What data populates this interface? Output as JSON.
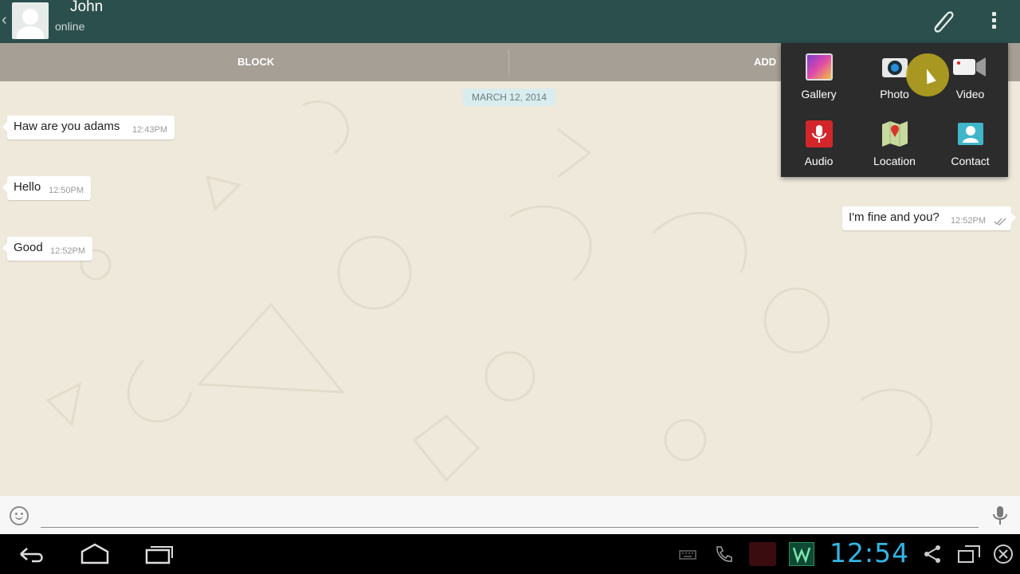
{
  "header": {
    "name": "John",
    "status": "online"
  },
  "actions": {
    "block": "BLOCK",
    "add": "ADD"
  },
  "chat": {
    "date": "MARCH 12, 2014",
    "messages": [
      {
        "text": "Haw are you adams",
        "time": "12:43PM",
        "dir": "in"
      },
      {
        "text": "Hello",
        "time": "12:50PM",
        "dir": "in"
      },
      {
        "text": "Good",
        "time": "12:52PM",
        "dir": "in"
      },
      {
        "text": "I'm fine and you?",
        "time": "12:52PM",
        "dir": "out"
      }
    ]
  },
  "attach_menu": {
    "items": [
      {
        "label": "Gallery",
        "icon": "gallery-icon"
      },
      {
        "label": "Photo",
        "icon": "camera-icon"
      },
      {
        "label": "Video",
        "icon": "video-camera-icon"
      },
      {
        "label": "Audio",
        "icon": "microphone-icon"
      },
      {
        "label": "Location",
        "icon": "map-icon"
      },
      {
        "label": "Contact",
        "icon": "contact-card-icon"
      }
    ]
  },
  "composer": {
    "value": "",
    "placeholder": ""
  },
  "system": {
    "clock": "12:54"
  },
  "colors": {
    "header": "#2b4f4c",
    "action_bar": "#a59f95",
    "accent_clock": "#33b5e5"
  }
}
